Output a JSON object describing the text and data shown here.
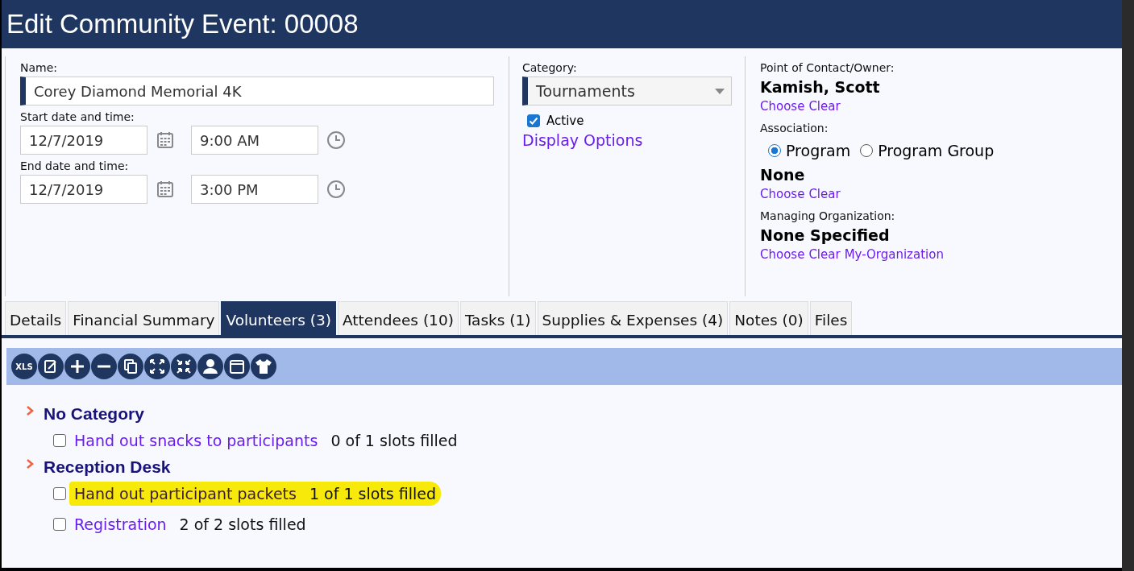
{
  "window": {
    "title": "Edit Community Event: 00008"
  },
  "form": {
    "name_label": "Name:",
    "name_value": "Corey Diamond Memorial 4K",
    "start_label": "Start date and time:",
    "start_date": "12/7/2019",
    "start_time": "9:00 AM",
    "end_label": "End date and time:",
    "end_date": "12/7/2019",
    "end_time": "3:00 PM",
    "category_label": "Category:",
    "category_value": "Tournaments",
    "active": {
      "label": "Active",
      "checked": true
    },
    "display_options": "Display Options"
  },
  "owner": {
    "contact_label": "Point of Contact/Owner:",
    "contact_value": "Kamish, Scott",
    "contact_links": [
      "Choose",
      "Clear"
    ],
    "association_label": "Association:",
    "association_options": [
      {
        "label": "Program",
        "selected": true
      },
      {
        "label": "Program Group",
        "selected": false
      }
    ],
    "association_value": "None",
    "association_links": [
      "Choose",
      "Clear"
    ],
    "org_label": "Managing Organization:",
    "org_value": "None Specified",
    "org_links": [
      "Choose",
      "Clear",
      "My-Organization"
    ]
  },
  "tabs": [
    {
      "label": "Details",
      "selected": false
    },
    {
      "label": "Financial Summary",
      "selected": false
    },
    {
      "label": "Volunteers (3)",
      "selected": true
    },
    {
      "label": "Attendees (10)",
      "selected": false
    },
    {
      "label": "Tasks (1)",
      "selected": false
    },
    {
      "label": "Supplies & Expenses (4)",
      "selected": false
    },
    {
      "label": "Notes (0)",
      "selected": false
    },
    {
      "label": "Files",
      "selected": false
    }
  ],
  "toolbar": [
    {
      "kind": "xls",
      "label": "XLS"
    },
    {
      "kind": "edit"
    },
    {
      "kind": "add"
    },
    {
      "kind": "remove"
    },
    {
      "kind": "copy"
    },
    {
      "kind": "expand"
    },
    {
      "kind": "collapse"
    },
    {
      "kind": "person"
    },
    {
      "kind": "calendar"
    },
    {
      "kind": "shirt"
    }
  ],
  "groups": [
    {
      "title": "No Category",
      "items": [
        {
          "label": "Hand out snacks to participants",
          "slots": "0 of 1 slots filled",
          "checked": false,
          "highlighted": false
        }
      ]
    },
    {
      "title": "Reception Desk",
      "items": [
        {
          "label": "Hand out participant packets",
          "slots": "1 of 1 slots filled",
          "checked": false,
          "highlighted": true
        },
        {
          "label": "Registration",
          "slots": "2 of 2 slots filled",
          "checked": false,
          "highlighted": false
        }
      ]
    }
  ]
}
